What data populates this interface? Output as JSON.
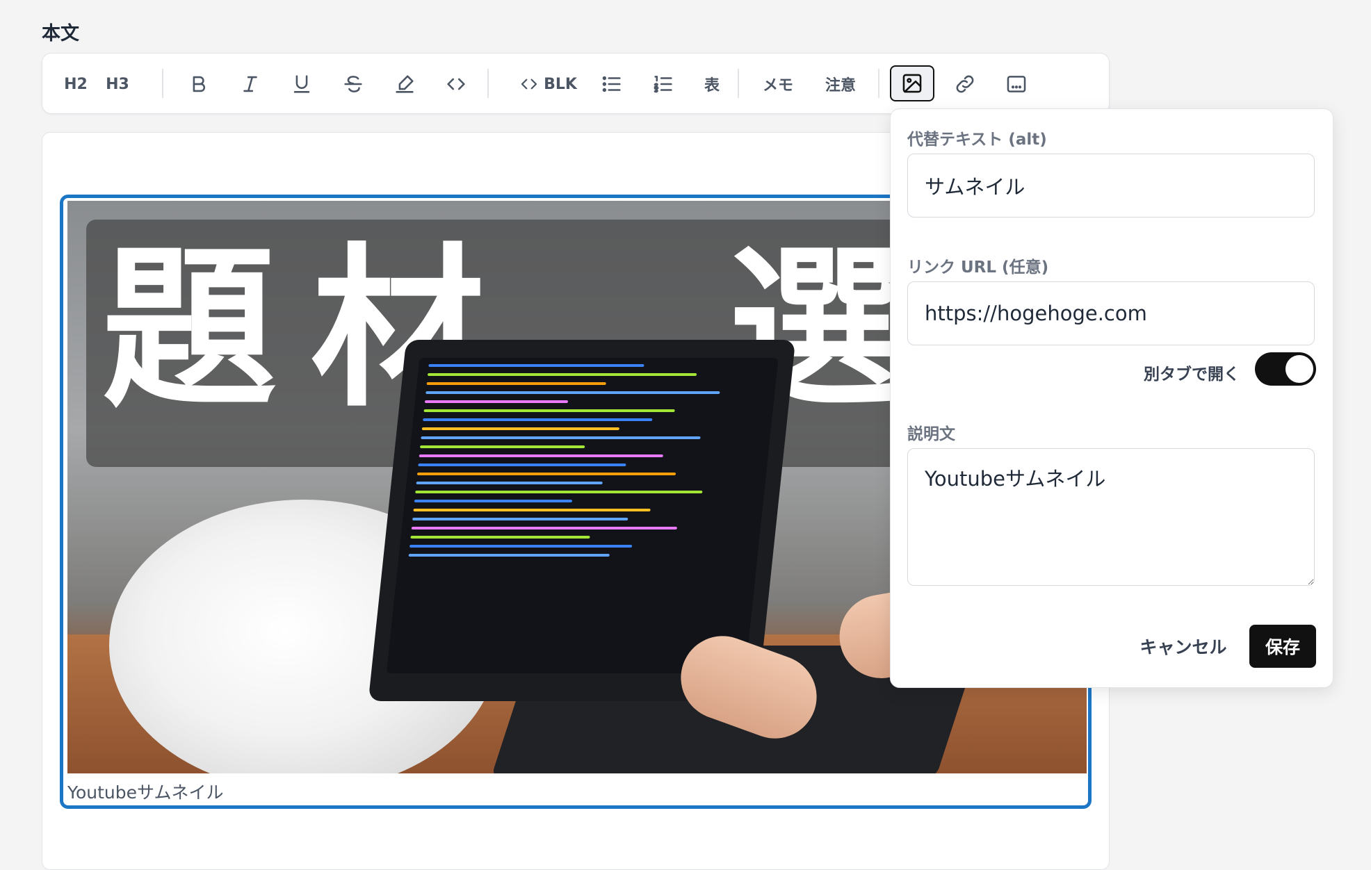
{
  "section": {
    "title": "本文"
  },
  "toolbar": {
    "h2": "H2",
    "h3": "H3",
    "code_block": "BLK",
    "table": "表",
    "memo": "メモ",
    "caution": "注意",
    "icons": [
      "bold-icon",
      "italic-icon",
      "underline-icon",
      "strikethrough-icon",
      "highlight-icon",
      "code-icon",
      "code-block-icon",
      "bullet-list-icon",
      "numbered-list-icon",
      "image-icon",
      "link-icon",
      "embed-icon"
    ]
  },
  "figure": {
    "overlay_text": "題材　選",
    "caption": "Youtubeサムネイル"
  },
  "image_popover": {
    "alt_label": "代替テキスト (alt)",
    "alt_value": "サムネイル",
    "link_label": "リンク URL (任意)",
    "link_value": "https://hogehoge.com",
    "new_tab_label": "別タブで開く",
    "new_tab_on": true,
    "description_label": "説明文",
    "description_value": "Youtubeサムネイル",
    "cancel_label": "キャンセル",
    "save_label": "保存"
  },
  "colors": {
    "selection_border": "#1c76c6",
    "primary_button": "#111111",
    "toggle_on": "#111111"
  }
}
